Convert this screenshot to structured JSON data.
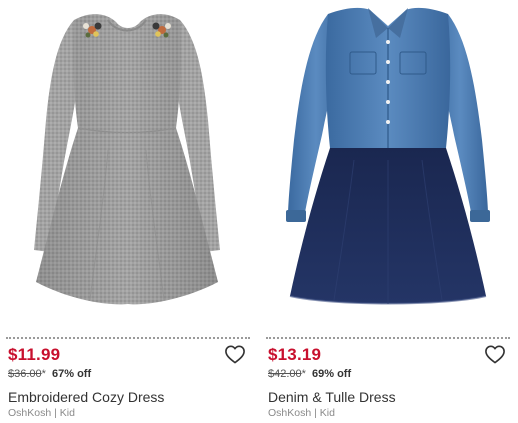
{
  "products": [
    {
      "image_alt": "Embroidered Cozy Dress",
      "price": "$11.99",
      "original_price": "$36.00",
      "original_marker": "*",
      "discount": "67% off",
      "title": "Embroidered Cozy Dress",
      "brand": "OshKosh | Kid",
      "icon": "heart-outline-icon"
    },
    {
      "image_alt": "Denim & Tulle Dress",
      "price": "$13.19",
      "original_price": "$42.00",
      "original_marker": "*",
      "discount": "69% off",
      "title": "Denim & Tulle Dress",
      "brand": "OshKosh | Kid",
      "icon": "heart-outline-icon"
    }
  ],
  "colors": {
    "sale_price": "#c8102e",
    "divider": "#9a9a9a",
    "sweater_gray": "#9d9d9d",
    "denim": "#4f7db0",
    "tulle_navy": "#1c2a52"
  }
}
